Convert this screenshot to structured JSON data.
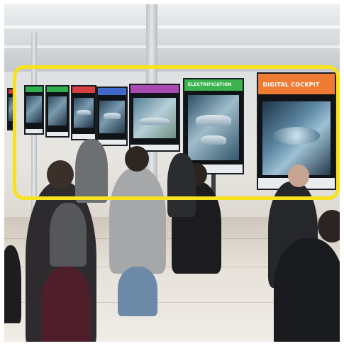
{
  "scene": {
    "description_free": true,
    "screens": [
      {
        "title": "",
        "accent": "#d63b3b"
      },
      {
        "title": "",
        "accent": "#2fae4e"
      },
      {
        "title": "",
        "accent": "#2fae4e"
      },
      {
        "title": "",
        "accent": "#d94141"
      },
      {
        "title": "",
        "accent": "#3f69c8"
      },
      {
        "title": "",
        "accent": "#a84bb0"
      },
      {
        "title": "ELECTRIFICATION",
        "accent": "#3bb34f"
      },
      {
        "title": "DIGITAL COCKPIT",
        "accent": "#ef7a32"
      }
    ],
    "highlight_color": "#f6e31b"
  }
}
